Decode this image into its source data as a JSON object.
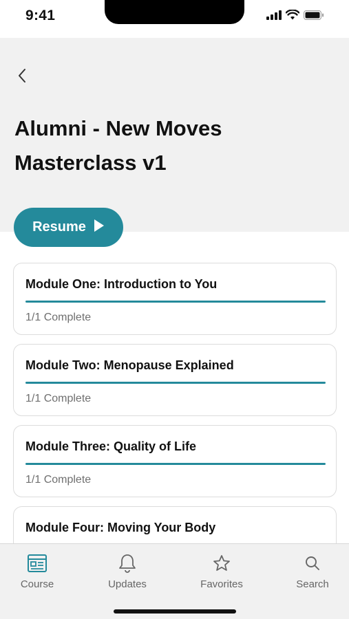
{
  "status_bar": {
    "time": "9:41"
  },
  "header": {
    "back_icon": "chevron-left-icon",
    "title": "Alumni - New Moves Masterclass v1",
    "background": "#f1f1f1"
  },
  "resume": {
    "label": "Resume",
    "icon": "play-icon",
    "color": "#248a9b"
  },
  "modules": [
    {
      "title": "Module One: Introduction to You",
      "status": "1/1 Complete",
      "progress": 1.0
    },
    {
      "title": "Module Two: Menopause Explained",
      "status": "1/1 Complete",
      "progress": 1.0
    },
    {
      "title": "Module Three: Quality of Life",
      "status": "1/1 Complete",
      "progress": 1.0
    },
    {
      "title": "Module Four: Moving Your Body"
    }
  ],
  "tab_bar": {
    "tabs": [
      {
        "label": "Course",
        "icon": "course-icon",
        "active": true
      },
      {
        "label": "Updates",
        "icon": "bell-icon",
        "active": false
      },
      {
        "label": "Favorites",
        "icon": "star-icon",
        "active": false
      },
      {
        "label": "Search",
        "icon": "search-icon",
        "active": false
      }
    ]
  },
  "colors": {
    "accent": "#248a9b",
    "card_border": "#dcdcdc",
    "muted_text": "#6f6f6f"
  }
}
